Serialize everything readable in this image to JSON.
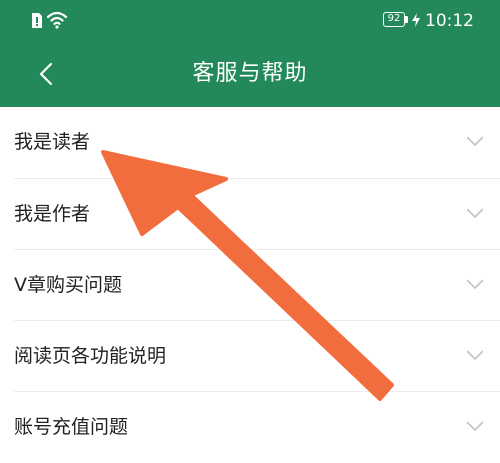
{
  "status_bar": {
    "battery_level": "92",
    "time": "10:12",
    "icons": [
      "sim-icon",
      "wifi-icon",
      "charging-icon"
    ]
  },
  "header": {
    "back_icon": "chevron-left-icon",
    "title": "客服与帮助"
  },
  "menu": {
    "items": [
      {
        "label": "我是读者"
      },
      {
        "label": "我是作者"
      },
      {
        "label": "V章购买问题"
      },
      {
        "label": "阅读页各功能说明"
      },
      {
        "label": "账号充值问题"
      }
    ]
  },
  "colors": {
    "header_background": "#23885a",
    "annotation_arrow": "#f26d3d",
    "text": "#222222",
    "chevron": "#c4c4c4",
    "divider": "#ececec"
  }
}
